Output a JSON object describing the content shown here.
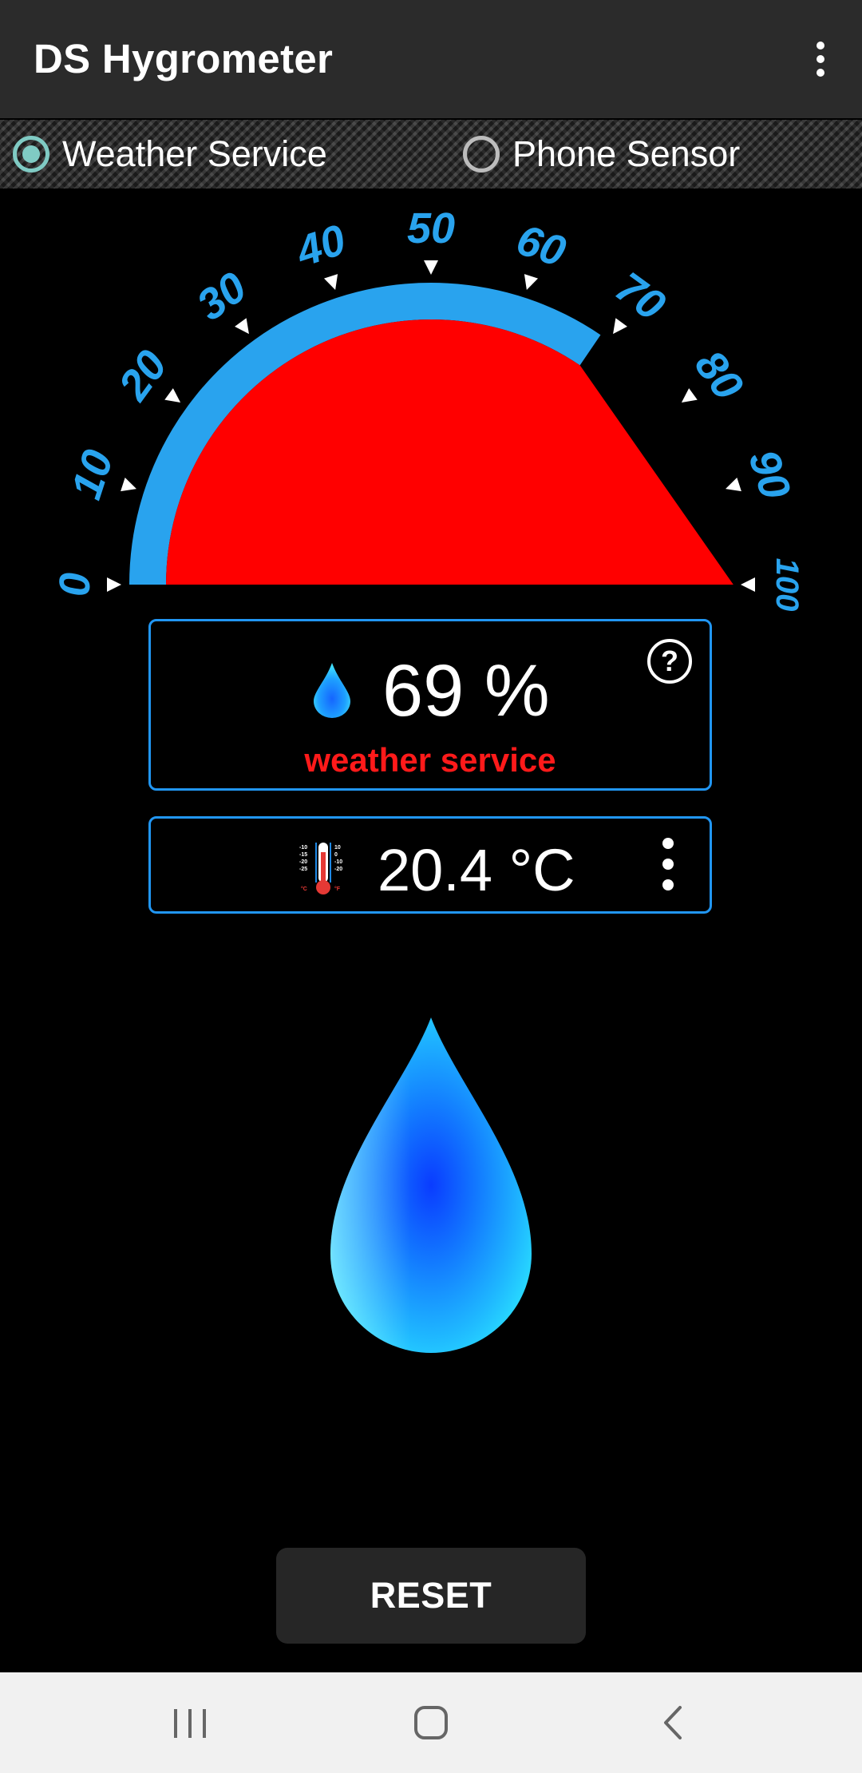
{
  "app": {
    "title": "DS Hygrometer"
  },
  "source_selector": {
    "options": [
      {
        "label": "Weather Service",
        "selected": true
      },
      {
        "label": "Phone Sensor",
        "selected": false
      }
    ],
    "accent_color": "#80cbc4"
  },
  "gauge": {
    "value_percent": 69,
    "min": 0,
    "max": 100,
    "tick_labels": [
      "0",
      "10",
      "20",
      "30",
      "40",
      "50",
      "60",
      "70",
      "80",
      "90",
      "100"
    ],
    "fill_color": "#ff0000",
    "arc_color": "#29a3ee"
  },
  "humidity": {
    "value": "69 %",
    "source": "weather service",
    "icon": "water-drop-icon",
    "help_symbol": "?"
  },
  "temperature": {
    "value": "20.4 °C",
    "icon": "thermometer-icon",
    "scale_c": [
      "-10",
      "-15",
      "-20",
      "-25"
    ],
    "scale_f": [
      "10",
      "0",
      "-10",
      "-20"
    ],
    "unit_c": "°C",
    "unit_f": "°F"
  },
  "buttons": {
    "reset": "RESET"
  },
  "navigation": {
    "icons": [
      "recent-apps-icon",
      "home-icon",
      "back-icon"
    ]
  }
}
